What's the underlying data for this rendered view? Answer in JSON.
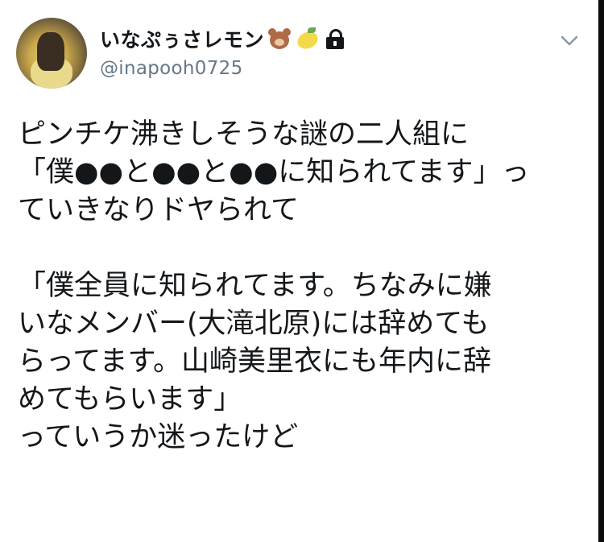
{
  "user": {
    "display_name": "いなぷぅさレモン",
    "handle": "@inapooh0725",
    "emojis": [
      "bear-icon",
      "lemon-icon"
    ],
    "protected_icon": "lock-icon"
  },
  "menu": {
    "icon": "chevron-down-icon"
  },
  "tweet": {
    "lines": [
      "ピンチケ沸きしそうな謎の二人組に",
      "「僕●●と●●と●●に知られてます」っ",
      "ていきなりドヤられて",
      "",
      "「僕全員に知られてます。ちなみに嫌",
      "いなメンバー(大滝北原)には辞めても",
      "らってます。山崎美里衣にも年内に辞",
      "めてもらいます」",
      "っていうか迷ったけど"
    ]
  },
  "colors": {
    "text": "#14171a",
    "secondary": "#657786",
    "background": "#ffffff"
  }
}
